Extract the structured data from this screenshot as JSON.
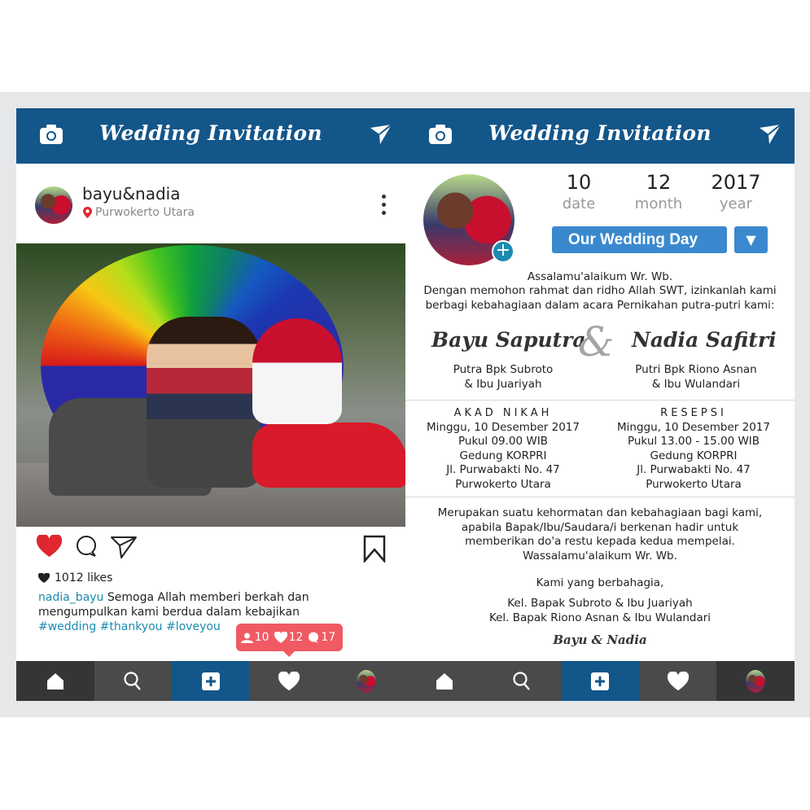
{
  "app_title": "Wedding Invitation",
  "left_panel": {
    "header": {
      "title": "Wedding Invitation",
      "left_icon": "camera-icon",
      "right_icon": "send-icon"
    },
    "post": {
      "username": "bayu&nadia",
      "location": "Purwokerto Utara",
      "likes": "1012 likes",
      "caption_user": "nadia_bayu",
      "caption_text": " Semoga Allah memberi berkah dan mengumpulkan kami berdua dalam kebajikan",
      "hashtags": "#wedding #thankyou #loveyou",
      "notification": {
        "followers": "10",
        "likes": "12",
        "comments": "17"
      }
    },
    "nav": [
      "home-icon",
      "search-icon",
      "add-icon",
      "heart-icon",
      "profile-avatar"
    ]
  },
  "right_panel": {
    "header": {
      "title": "Wedding Invitation"
    },
    "date": {
      "day": "10",
      "day_label": "date",
      "month": "12",
      "month_label": "month",
      "year": "2017",
      "year_label": "year"
    },
    "wedding_button": "Our Wedding Day",
    "dropdown_arrow": "▼",
    "greeting": "Assalamu'alaikum Wr. Wb.",
    "intro_line1": "Dengan memohon rahmat dan ridho Allah SWT, izinkanlah kami",
    "intro_line2": "berbagi kebahagiaan dalam acara Pernikahan putra-putri kami:",
    "groom": {
      "name": "Bayu Saputra",
      "parents_line1": "Putra Bpk Subroto",
      "parents_line2": "& Ibu Juariyah"
    },
    "ampersand": "&",
    "bride": {
      "name": "Nadia Safitri",
      "parents_line1": "Putri Bpk Riono Asnan",
      "parents_line2": "& Ibu Wulandari"
    },
    "akad": {
      "title": "AKAD NIKAH",
      "date": "Minggu, 10 Desember 2017",
      "time": "Pukul 09.00 WIB",
      "venue": "Gedung KORPRI",
      "address": "Jl. Purwabakti No. 47",
      "city": "Purwokerto Utara"
    },
    "resepsi": {
      "title": "RESEPSI",
      "date": "Minggu, 10 Desember 2017",
      "time": "Pukul 13.00 - 15.00 WIB",
      "venue": "Gedung KORPRI",
      "address": "Jl. Purwabakti No. 47",
      "city": "Purwokerto Utara"
    },
    "closing_line1": "Merupakan suatu kehormatan dan kebahagiaan bagi kami,",
    "closing_line2": "apabila Bapak/Ibu/Saudara/i berkenan hadir untuk",
    "closing_line3": "memberikan do'a restu kepada kedua mempelai.",
    "closing_line4": "Wassalamu'alaikum Wr. Wb.",
    "regards": "Kami yang berbahagia,",
    "family1": "Kel. Bapak Subroto & Ibu Juariyah",
    "family2": "Kel. Bapak Riono Asnan & Ibu Wulandari",
    "signature": "Bayu & Nadia"
  },
  "colors": {
    "header": "#13568a",
    "button": "#3a89cf",
    "badge": "#f05a63",
    "link": "#1a8bb0",
    "heart": "#e0262f"
  }
}
